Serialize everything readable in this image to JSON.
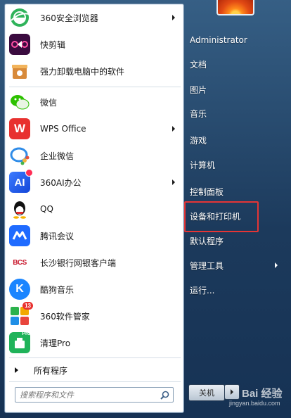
{
  "start_menu": {
    "programs": [
      {
        "label": "360安全浏览器",
        "icon": "360-browser-icon",
        "has_submenu": true
      },
      {
        "label": "快剪辑",
        "icon": "kuaijianji-icon",
        "has_submenu": false
      },
      {
        "label": "强力卸载电脑中的软件",
        "icon": "uninstaller-icon",
        "has_submenu": false
      },
      {
        "label": "微信",
        "icon": "wechat-icon",
        "has_submenu": false
      },
      {
        "label": "WPS Office",
        "icon": "wps-icon",
        "has_submenu": true
      },
      {
        "label": "企业微信",
        "icon": "wecom-icon",
        "has_submenu": false
      },
      {
        "label": "360AI办公",
        "icon": "360ai-office-icon",
        "has_submenu": true
      },
      {
        "label": "QQ",
        "icon": "qq-penguin-icon",
        "has_submenu": false
      },
      {
        "label": "腾讯会议",
        "icon": "tencent-meeting-icon",
        "has_submenu": false
      },
      {
        "label": "长沙银行网银客户端",
        "icon": "bcs-bank-icon",
        "has_submenu": false
      },
      {
        "label": "酷狗音乐",
        "icon": "kugou-music-icon",
        "has_submenu": false
      },
      {
        "label": "360软件管家",
        "icon": "360-software-manager-icon",
        "has_submenu": false
      },
      {
        "label": "清理Pro",
        "icon": "cleaner-pro-icon",
        "has_submenu": false
      }
    ],
    "icon_text": {
      "wps": "W",
      "ai": "AI",
      "bcs": "BCS",
      "kugou": "K",
      "badge_13": "13",
      "pro": "Pro"
    },
    "all_programs_label": "所有程序",
    "search_placeholder": "搜索程序和文件",
    "right_items": [
      {
        "label": "Administrator",
        "has_submenu": false
      },
      {
        "label": "文档",
        "has_submenu": false
      },
      {
        "label": "图片",
        "has_submenu": false
      },
      {
        "label": "音乐",
        "has_submenu": false
      },
      {
        "label": "游戏",
        "has_submenu": false
      },
      {
        "label": "计算机",
        "has_submenu": false
      },
      {
        "label": "控制面板",
        "has_submenu": false
      },
      {
        "label": "设备和打印机",
        "has_submenu": false,
        "highlighted": true
      },
      {
        "label": "默认程序",
        "has_submenu": false
      },
      {
        "label": "管理工具",
        "has_submenu": true
      },
      {
        "label": "运行...",
        "has_submenu": false
      }
    ],
    "shutdown_label": "关机",
    "highlight_color": "#e53535"
  },
  "watermark": {
    "brand": "Bai 经验",
    "url": "jingyan.baidu.com"
  }
}
